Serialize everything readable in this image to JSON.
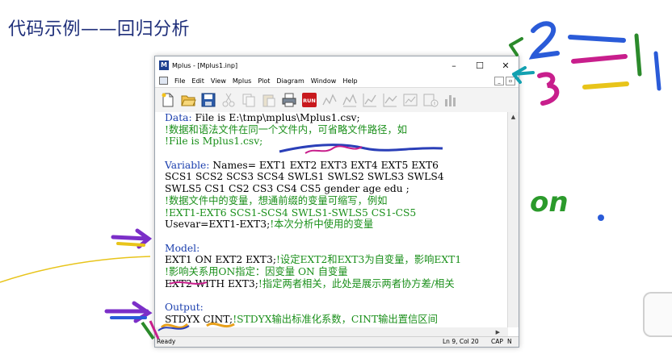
{
  "slide": {
    "title": "代码示例——回归分析"
  },
  "window": {
    "title": "Mplus - [Mplus1.inp]",
    "controls": [
      "–",
      "☐",
      "✕"
    ]
  },
  "menu": [
    "File",
    "Edit",
    "View",
    "Mplus",
    "Plot",
    "Diagram",
    "Window",
    "Help"
  ],
  "toolbar": {
    "icons": [
      "new-icon",
      "open-icon",
      "save-icon",
      "cut-icon",
      "copy-icon",
      "paste-icon",
      "print-icon",
      "run-icon",
      "plot-icon",
      "plot2-icon",
      "plot3-icon",
      "plot4-icon",
      "plot5-icon",
      "info-icon",
      "bar-icon"
    ],
    "run_label": "RUN"
  },
  "editor": {
    "lines": [
      [
        {
          "t": "Data:",
          "c": "kw"
        },
        {
          "t": " File is E:\\tmp\\mplus\\Mplus1.csv;",
          "c": "tx"
        }
      ],
      [
        {
          "t": "!数据和语法文件在同一个文件内，可省略文件路径，如",
          "c": "cm"
        }
      ],
      [
        {
          "t": "!File is Mplus1.csv;",
          "c": "cm"
        }
      ],
      [
        {
          "t": "",
          "c": "tx"
        }
      ],
      [
        {
          "t": "Variable:",
          "c": "kw"
        },
        {
          "t": " Names= EXT1 EXT2 EXT3 EXT4 EXT5 EXT6",
          "c": "tx"
        }
      ],
      [
        {
          "t": "SCS1 SCS2 SCS3 SCS4 SWLS1 SWLS2 SWLS3 SWLS4",
          "c": "tx"
        }
      ],
      [
        {
          "t": "SWLS5 CS1 CS2 CS3 CS4 CS5 gender age edu ;",
          "c": "tx"
        }
      ],
      [
        {
          "t": "!数据文件中的变量，想通前缀的变量可缩写，例如",
          "c": "cm"
        }
      ],
      [
        {
          "t": "!EXT1-EXT6 SCS1-SCS4 SWLS1-SWLS5 CS1-CS5",
          "c": "cm"
        }
      ],
      [
        {
          "t": "Usevar=EXT1-EXT3;",
          "c": "tx"
        },
        {
          "t": "!本次分析中使用的变量",
          "c": "cm"
        }
      ],
      [
        {
          "t": "",
          "c": "tx"
        }
      ],
      [
        {
          "t": "Model:",
          "c": "kw"
        }
      ],
      [
        {
          "t": "EXT1 ON EXT2 EXT3;",
          "c": "tx"
        },
        {
          "t": "!设定EXT2和EXT3为自变量，影响EXT1",
          "c": "cm"
        }
      ],
      [
        {
          "t": "!影响关系用ON指定：因变量 ON 自变量",
          "c": "cm"
        }
      ],
      [
        {
          "t": "EXT2 WITH EXT3;",
          "c": "tx"
        },
        {
          "t": "!指定两者相关，此处是展示两者协方差/相关",
          "c": "cm"
        }
      ],
      [
        {
          "t": "",
          "c": "tx"
        }
      ],
      [
        {
          "t": "Output:",
          "c": "kw"
        }
      ],
      [
        {
          "t": "STDYX CINT;",
          "c": "tx"
        },
        {
          "t": "!STDYX输出标准化系数，CINT输出置信区间",
          "c": "cm"
        }
      ]
    ]
  },
  "status": {
    "text": "Ready",
    "position": "Ln 9, Col 20",
    "caps": "CAP",
    "num": "N"
  },
  "annotations": {
    "on_text": "on",
    "colors": {
      "pen_blue": "#2a5bd8",
      "pen_magenta": "#c81e8c",
      "pen_yellow": "#e8c41a",
      "pen_green": "#2b8a2b",
      "pen_teal": "#12a0b0"
    }
  }
}
